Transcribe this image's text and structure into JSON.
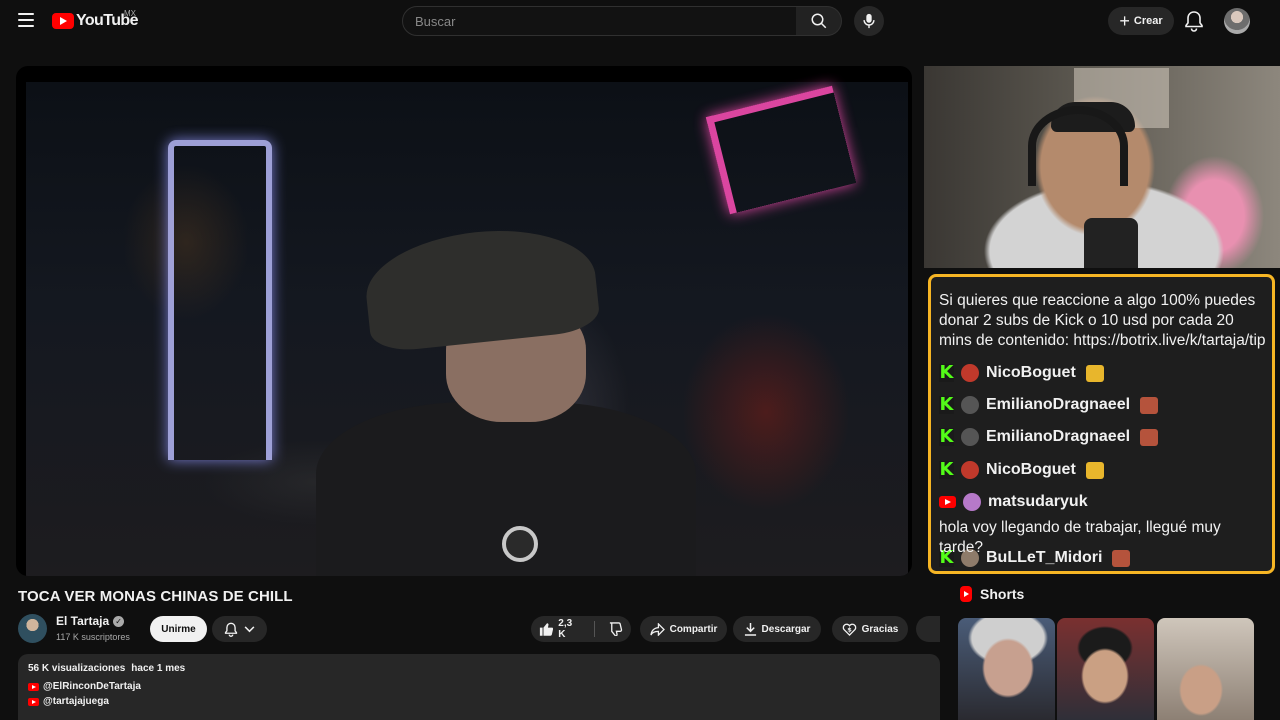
{
  "header": {
    "logo_text": "YouTube",
    "logo_country": "MX",
    "search_placeholder": "Buscar",
    "create_label": "Crear"
  },
  "video": {
    "title": "TOCA VER MONAS CHINAS DE CHILL",
    "channel_name": "El Tartaja",
    "channel_subs": "117 K suscriptores",
    "join_label": "Unirme",
    "like_count": "2,3 K",
    "share_label": "Compartir",
    "download_label": "Descargar",
    "thanks_label": "Gracias"
  },
  "description": {
    "views": "56 K visualizaciones",
    "date": "hace 1 mes",
    "links": [
      "@ElRinconDeTartaja",
      "@tartajajuega"
    ]
  },
  "chat": {
    "bot_message": "Si quieres que reaccione a algo 100% puedes donar 2 subs de Kick o 10 usd por cada 20 mins de contenido: https://botrix.live/k/tartaja/tip",
    "rows": [
      {
        "platform": "kick",
        "user": "NicoBoguet",
        "avatar_color": "#c0392b",
        "emote_color": "#e8b62c"
      },
      {
        "platform": "kick",
        "user": "EmilianoDragnaeel",
        "avatar_color": "#555555",
        "emote_color": "#b5533c"
      },
      {
        "platform": "kick",
        "user": "EmilianoDragnaeel",
        "avatar_color": "#555555",
        "emote_color": "#b5533c"
      },
      {
        "platform": "kick",
        "user": "NicoBoguet",
        "avatar_color": "#c0392b",
        "emote_color": "#e8b62c"
      },
      {
        "platform": "youtube",
        "user": "matsudaryuk",
        "avatar_color": "#b679c9",
        "emote_color": ""
      },
      {
        "platform": "kick",
        "user": "BuLLeT_Midori",
        "avatar_color": "#8e7b6a",
        "emote_color": "#b5533c"
      }
    ],
    "youtube_message": "hola voy llegando de trabajar, llegué muy tarde?",
    "accent_color": "#f6b524",
    "kick_color": "#53fc18"
  },
  "shorts": {
    "label": "Shorts"
  },
  "icons": [
    "menu-icon",
    "search-icon",
    "mic-icon",
    "plus-icon",
    "bell-icon",
    "like-icon",
    "dislike-icon",
    "share-icon",
    "download-icon",
    "thanks-icon",
    "chevron-down-icon",
    "verified-icon",
    "kick-icon",
    "youtube-icon",
    "shorts-icon"
  ]
}
